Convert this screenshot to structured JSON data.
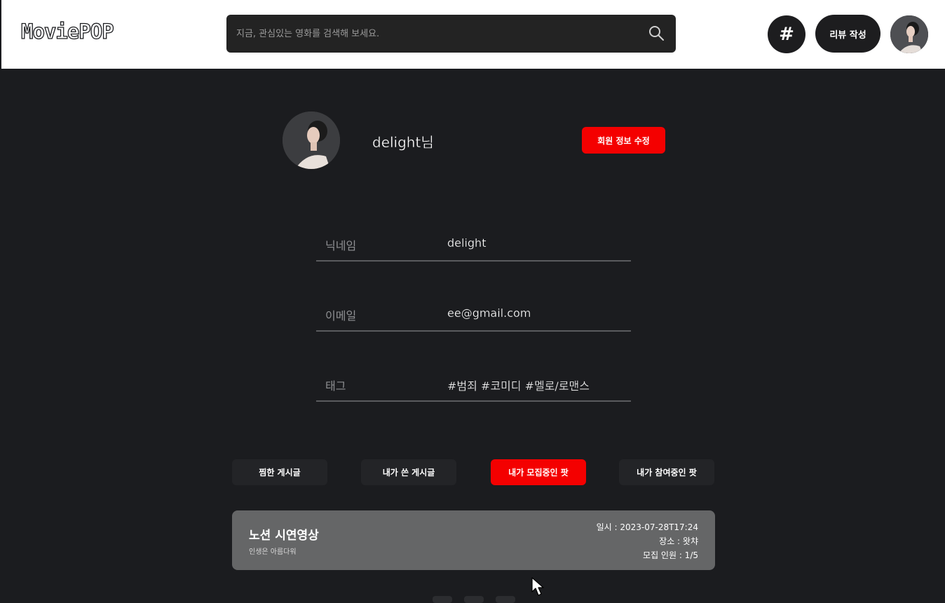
{
  "header": {
    "logo": "MoviePOP",
    "search_placeholder": "지금, 관심있는 영화를 검색해 보세요.",
    "hash_label": "#",
    "write_review_label": "리뷰 작성"
  },
  "profile": {
    "username": "delight님",
    "edit_button": "회원 정보 수정"
  },
  "fields": [
    {
      "label": "닉네임",
      "value": "delight"
    },
    {
      "label": "이메일",
      "value": "ee@gmail.com"
    },
    {
      "label": "태그",
      "value": "#범죄 #코미디 #멜로/로맨스"
    }
  ],
  "tabs": [
    {
      "label": "찜한 게시글",
      "active": false
    },
    {
      "label": "내가 쓴 게시글",
      "active": false
    },
    {
      "label": "내가 모집중인 팟",
      "active": true
    },
    {
      "label": "내가 참여중인 팟",
      "active": false
    }
  ],
  "card": {
    "title": "노션 시연영상",
    "subtitle": "인생은 아름다워",
    "date": "일시 : 2023-07-28T17:24",
    "place": "장소 : 왓챠",
    "members": "모집 인원 : 1/5"
  },
  "colors": {
    "accent": "#f40000",
    "background": "#1b1c1f",
    "card": "#656667"
  },
  "icons": [
    "search-icon",
    "hash-icon",
    "avatar",
    "cursor-icon"
  ]
}
